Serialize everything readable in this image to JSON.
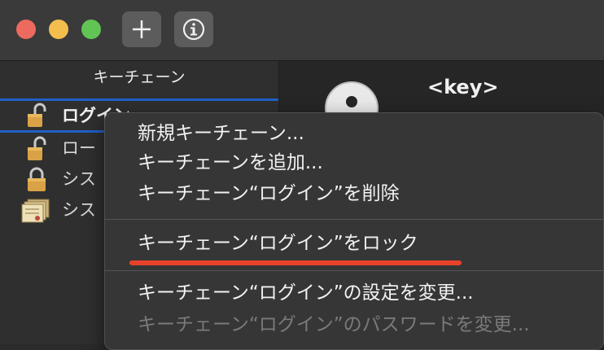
{
  "titlebar": {
    "buttons": [
      {
        "name": "add-keychain-button",
        "icon": "plus-icon"
      },
      {
        "name": "info-button",
        "icon": "info-icon"
      }
    ]
  },
  "sidebar": {
    "header": "キーチェーン",
    "items": [
      {
        "label": "ログイン",
        "icon": "lock-open-icon",
        "selected": true
      },
      {
        "label": "ロー",
        "icon": "lock-open-icon"
      },
      {
        "label": "シス",
        "icon": "lock-closed-icon"
      },
      {
        "label": "シス",
        "icon": "certificate-icon"
      }
    ]
  },
  "detail": {
    "title": "<key>"
  },
  "context_menu": {
    "items": [
      {
        "label": "新規キーチェーン...",
        "enabled": true
      },
      {
        "label": "キーチェーンを追加...",
        "enabled": true
      },
      {
        "label": "キーチェーン“ログイン”を削除",
        "enabled": true
      },
      {
        "label": "キーチェーン“ログイン”をロック",
        "enabled": true,
        "highlighted_annotation": true
      },
      {
        "label": "キーチェーン“ログイン”の設定を変更...",
        "enabled": true
      },
      {
        "label": "キーチェーン“ログイン”のパスワードを変更...",
        "enabled": false
      }
    ],
    "annotation_color": "#e8412a"
  },
  "colors": {
    "selection_border": "#2060c8",
    "close": "#ec6a5e",
    "minimize": "#f4be4f",
    "zoom": "#61c454"
  }
}
